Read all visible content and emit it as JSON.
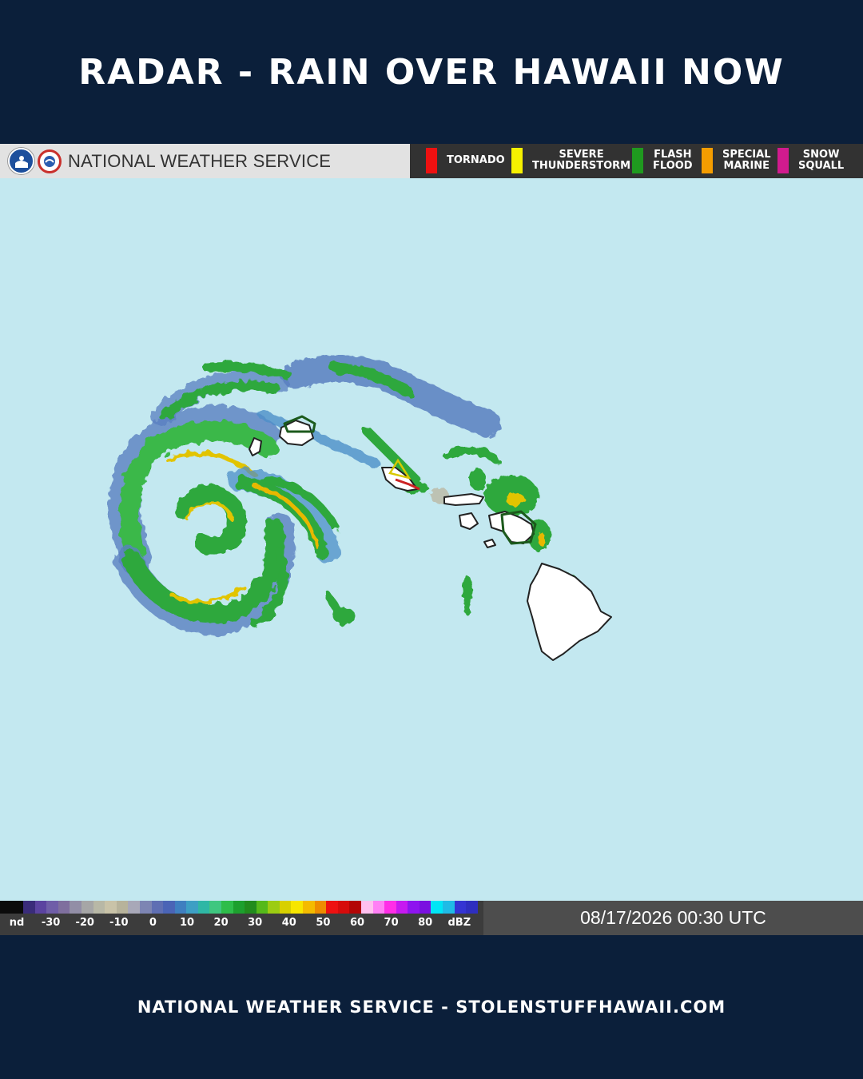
{
  "header": {
    "title": "RADAR - RAIN OVER HAWAII NOW"
  },
  "nws": {
    "title": "NATIONAL WEATHER SERVICE",
    "logos": [
      "noaa-logo",
      "nws-logo"
    ]
  },
  "warning_legend": [
    {
      "label_lines": [
        "TORNADO"
      ],
      "color": "#ee1111"
    },
    {
      "label_lines": [
        "SEVERE",
        "THUNDERSTORM"
      ],
      "color": "#f7f100"
    },
    {
      "label_lines": [
        "FLASH",
        "FLOOD"
      ],
      "color": "#1f9a1f"
    },
    {
      "label_lines": [
        "SPECIAL",
        "MARINE"
      ],
      "color": "#f59d00"
    },
    {
      "label_lines": [
        "SNOW",
        "SQUALL"
      ],
      "color": "#d11b8e"
    }
  ],
  "colors": {
    "ocean": "#c3e8f0",
    "land": "#ffffff",
    "background": "#0b1f3a"
  },
  "scale": {
    "ticks": [
      "nd",
      "-30",
      "-20",
      "-10",
      "0",
      "10",
      "20",
      "30",
      "40",
      "50",
      "60",
      "70",
      "80",
      "dBZ"
    ],
    "ramp": [
      "#0b0b0b",
      "#0b0b0b",
      "#3a2c7a",
      "#5b43a0",
      "#6f5ea8",
      "#7f6f9e",
      "#928ea6",
      "#a6a6a6",
      "#b8b8a6",
      "#c9c3a8",
      "#b7b39b",
      "#a8a8b8",
      "#7d85b3",
      "#5f6fb3",
      "#4a64b6",
      "#3f7fc0",
      "#3d9fc4",
      "#2fb7a5",
      "#3fc780",
      "#2ebd4a",
      "#1da02e",
      "#218c1d",
      "#55b91a",
      "#9ccc12",
      "#d8d000",
      "#f7e600",
      "#f4bb00",
      "#ee8c00",
      "#ee1111",
      "#d60b0b",
      "#b30606",
      "#ffc0ef",
      "#ff80f5",
      "#ff2ee7",
      "#c61af0",
      "#8e14ef",
      "#7a10e0",
      "#00e5f5",
      "#1fbbe6",
      "#3434d3",
      "#2e2ebf"
    ]
  },
  "timestamp": "08/17/2026 00:30 UTC",
  "footer": {
    "text": "NATIONAL WEATHER SERVICE - STOLENSTUFFHAWAII.COM"
  }
}
